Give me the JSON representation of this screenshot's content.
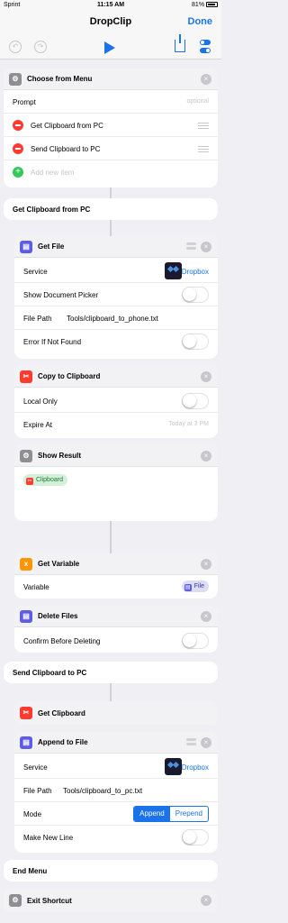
{
  "status": {
    "carrier": "Sprint",
    "time": "11:15 AM",
    "battery": "81%"
  },
  "nav": {
    "title": "DropClip",
    "done": "Done"
  },
  "icons": {
    "undo": "undo-icon",
    "redo": "redo-icon",
    "play": "play-icon",
    "share": "share-icon",
    "settings": "toggles-icon",
    "accent": "#1a73e8",
    "close": "×"
  },
  "menu": {
    "title": "Choose from Menu",
    "prompt_label": "Prompt",
    "prompt_placeholder": "optional",
    "items": [
      "Get Clipboard from PC",
      "Send Clipboard to PC"
    ],
    "add": "Add new item"
  },
  "section1": "Get Clipboard from PC",
  "get_file": {
    "title": "Get File",
    "service_label": "Service",
    "service": "Dropbox",
    "picker_label": "Show Document Picker",
    "path_label": "File Path",
    "path": "Tools/clipboard_to_phone.txt",
    "error_label": "Error If Not Found"
  },
  "copy": {
    "title": "Copy to Clipboard",
    "local_label": "Local Only",
    "expire_label": "Expire At",
    "expire_placeholder": "Today at 3 PM"
  },
  "show_result": {
    "title": "Show Result",
    "token": "Clipboard"
  },
  "get_var": {
    "title": "Get Variable",
    "var_label": "Variable",
    "token": "File"
  },
  "delete": {
    "title": "Delete Files",
    "confirm_label": "Confirm Before Deleting"
  },
  "section2": "Send Clipboard to PC",
  "get_clip": {
    "title": "Get Clipboard"
  },
  "append": {
    "title": "Append to File",
    "service_label": "Service",
    "service": "Dropbox",
    "path_label": "File Path",
    "path": "Tools/clipboard_to_pc.txt",
    "mode_label": "Mode",
    "mode_options": [
      "Append",
      "Prepend"
    ],
    "newline_label": "Make New Line"
  },
  "end_menu": "End Menu",
  "exit": {
    "title": "Exit Shortcut"
  }
}
